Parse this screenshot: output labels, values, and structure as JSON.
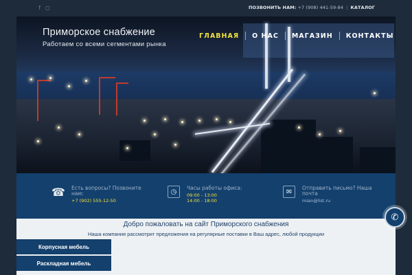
{
  "topbar": {
    "social_icons": [
      "facebook-icon",
      "instagram-icon"
    ],
    "callback_label": "ПОЗВОНИТЬ НАМ:",
    "phone": "+7 (908) 441-59-84",
    "separator": "|",
    "catalog_label": "КАТАЛОГ"
  },
  "brand": {
    "title": "Приморское снабжение",
    "subtitle": "Работаем со всеми сегментами рынка"
  },
  "nav": {
    "items": [
      {
        "label": "ГЛАВНАЯ",
        "active": true
      },
      {
        "label": "О НАС",
        "active": false
      },
      {
        "label": "МАГАЗИН",
        "active": false
      },
      {
        "label": "КОНТАКТЫ",
        "active": false
      }
    ]
  },
  "info": {
    "call": {
      "label": "Есть вопросы? Позвоните нам:",
      "value": "+7 (902) 555-12-50",
      "icon": "telephone-icon"
    },
    "hours": {
      "label": "Часы работы офиса:",
      "value1": "09:00 - 13:00",
      "value2": "14:00 - 18:00",
      "icon": "clock-icon"
    },
    "mail": {
      "label": "Отправить письмо? Наша почта",
      "value": "mian@list.ru",
      "icon": "mail-icon"
    }
  },
  "welcome": {
    "title": "Добро пожаловать на сайт Приморского снабжения",
    "subtitle": "Наша компания рассмотрит предложения на регулярные поставки в Ваш адрес, любой продукции"
  },
  "sidebar": {
    "items": [
      {
        "label": "Корпусная мебель"
      },
      {
        "label": "Раскладная мебель"
      }
    ]
  },
  "colors": {
    "background": "#1d2b3a",
    "accent": "#f2e23c",
    "infobar": "#13406d",
    "welcome_bg": "#eef1f4"
  }
}
